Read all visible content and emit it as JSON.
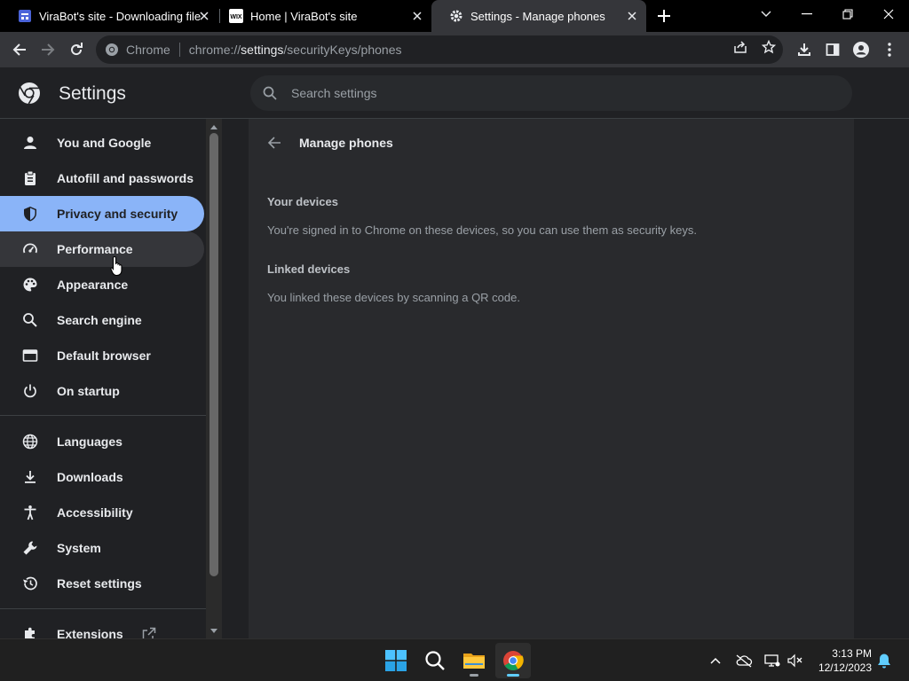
{
  "browser": {
    "tabs": [
      {
        "title": "ViraBot's site - Downloading file",
        "active": false
      },
      {
        "title": "Home | ViraBot's site",
        "active": false
      },
      {
        "title": "Settings - Manage phones",
        "active": true
      }
    ],
    "omnibox": {
      "chip": "Chrome",
      "url_scheme": "chrome://",
      "url_host": "settings",
      "url_path": "/securityKeys/phones"
    }
  },
  "settings": {
    "title": "Settings",
    "search_placeholder": "Search settings",
    "nav": [
      {
        "label": "You and Google",
        "icon": "person-icon"
      },
      {
        "label": "Autofill and passwords",
        "icon": "clipboard-icon"
      },
      {
        "label": "Privacy and security",
        "icon": "shield-icon",
        "state": "active"
      },
      {
        "label": "Performance",
        "icon": "speedometer-icon",
        "state": "hover"
      },
      {
        "label": "Appearance",
        "icon": "palette-icon"
      },
      {
        "label": "Search engine",
        "icon": "search-icon"
      },
      {
        "label": "Default browser",
        "icon": "browser-window-icon"
      },
      {
        "label": "On startup",
        "icon": "power-icon"
      }
    ],
    "nav_advanced": [
      {
        "label": "Languages",
        "icon": "globe-icon"
      },
      {
        "label": "Downloads",
        "icon": "download-icon"
      },
      {
        "label": "Accessibility",
        "icon": "accessibility-icon"
      },
      {
        "label": "System",
        "icon": "wrench-icon"
      },
      {
        "label": "Reset settings",
        "icon": "history-icon"
      }
    ],
    "nav_footer": [
      {
        "label": "Extensions",
        "icon": "puzzle-icon"
      }
    ]
  },
  "page": {
    "heading": "Manage phones",
    "sections": [
      {
        "title": "Your devices",
        "description": "You're signed in to Chrome on these devices, so you can use them as security keys."
      },
      {
        "title": "Linked devices",
        "description": "You linked these devices by scanning a QR code."
      }
    ]
  },
  "taskbar": {
    "time": "3:13 PM",
    "date": "12/12/2023"
  },
  "colors": {
    "accent": "#8ab4f8",
    "background": "#202124",
    "card": "#292a2d"
  }
}
